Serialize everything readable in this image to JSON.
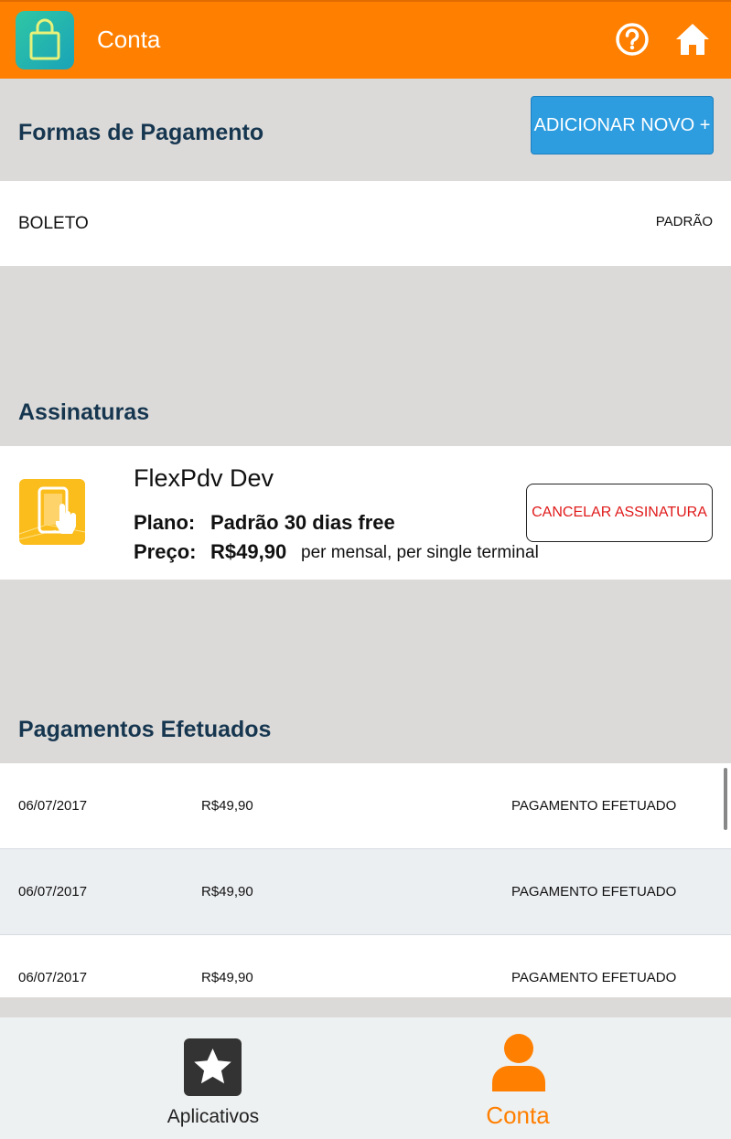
{
  "topbar": {
    "title": "Conta"
  },
  "payment_methods": {
    "title": "Formas de Pagamento",
    "add_label": "ADICIONAR NOVO +",
    "items": [
      {
        "name": "BOLETO",
        "status": "PADRÃO"
      }
    ]
  },
  "subscriptions": {
    "title": "Assinaturas",
    "item": {
      "name": "FlexPdv Dev",
      "plan_label": "Plano:",
      "plan_value": "Padrão 30 dias free",
      "price_label": "Preço:",
      "price_value": "R$49,90",
      "price_note": "per mensal, per single terminal",
      "cancel_label": "CANCELAR ASSINATURA"
    }
  },
  "payments": {
    "title": "Pagamentos Efetuados",
    "rows": [
      {
        "date": "06/07/2017",
        "amount": "R$49,90",
        "status": "PAGAMENTO EFETUADO"
      },
      {
        "date": "06/07/2017",
        "amount": "R$49,90",
        "status": "PAGAMENTO EFETUADO"
      },
      {
        "date": "06/07/2017",
        "amount": "R$49,90",
        "status": "PAGAMENTO EFETUADO"
      }
    ]
  },
  "bottom_nav": {
    "items": [
      {
        "label": "Aplicativos",
        "icon": "star-icon"
      },
      {
        "label": "Conta",
        "icon": "user-icon",
        "active": true
      }
    ]
  },
  "colors": {
    "brand": "#ff7f00",
    "accent": "#2d9de0",
    "danger": "#e01a1a",
    "heading": "#163650"
  }
}
